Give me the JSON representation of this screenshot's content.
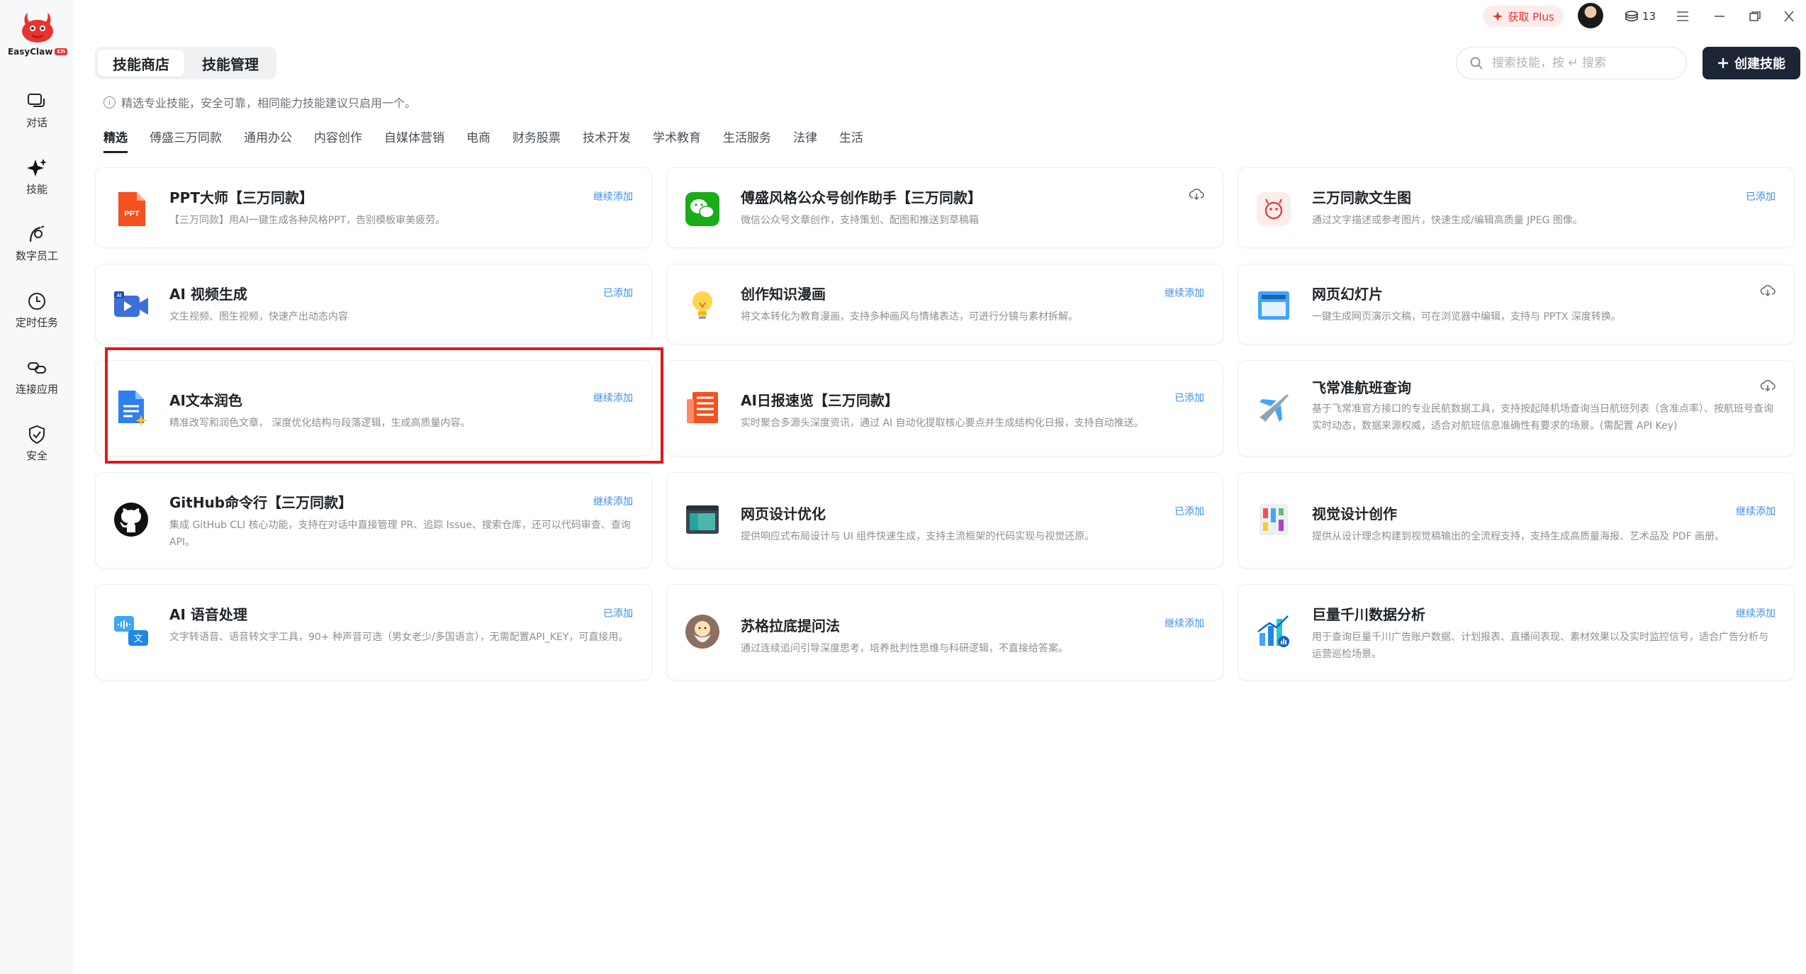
{
  "app": {
    "name": "EasyClaw",
    "badge": "cn"
  },
  "sidebar": {
    "items": [
      {
        "label": "对话",
        "icon": "chat-icon"
      },
      {
        "label": "技能",
        "icon": "sparkle-icon"
      },
      {
        "label": "数字员工",
        "icon": "digital-employee-icon"
      },
      {
        "label": "定时任务",
        "icon": "clock-icon"
      },
      {
        "label": "连接应用",
        "icon": "link-icon"
      },
      {
        "label": "安全",
        "icon": "shield-icon"
      }
    ]
  },
  "topbar": {
    "plus_label": "获取 Plus",
    "credits": "13"
  },
  "tabs": {
    "store": "技能商店",
    "manage": "技能管理"
  },
  "search": {
    "placeholder": "搜索技能，按 ↵ 搜索"
  },
  "create_button": "创建技能",
  "notice": "精选专业技能，安全可靠，相同能力技能建议只启用一个。",
  "categories": [
    "精选",
    "傅盛三万同款",
    "通用办公",
    "内容创作",
    "自媒体营销",
    "电商",
    "财务股票",
    "技术开发",
    "学术教育",
    "生活服务",
    "法律",
    "生活"
  ],
  "cards": [
    {
      "title": "PPT大师【三万同款】",
      "desc": "【三万同款】用AI一键生成各种风格PPT，告别模板审美疲劳。",
      "action": "继续添加",
      "icon": "ppt-icon"
    },
    {
      "title": "傅盛风格公众号创作助手【三万同款】",
      "desc": "微信公众号文章创作，支持策划、配图和推送到草稿箱",
      "action": "",
      "icon": "wechat-icon"
    },
    {
      "title": "三万同款文生图",
      "desc": "通过文字描述或参考图片，快速生成/编辑高质量 JPEG 图像。",
      "action": "已添加",
      "icon": "lobster-icon"
    },
    {
      "title": "AI 视频生成",
      "desc": "文生视频、图生视频，快速产出动态内容",
      "action": "已添加",
      "icon": "video-camera-icon"
    },
    {
      "title": "创作知识漫画",
      "desc": "将文本转化为教育漫画，支持多种画风与情绪表达，可进行分镜与素材拆解。",
      "action": "继续添加",
      "icon": "lightbulb-icon"
    },
    {
      "title": "网页幻灯片",
      "desc": "一键生成网页演示文稿，可在浏览器中编辑，支持与 PPTX 深度转换。",
      "action": "",
      "icon": "slides-icon"
    },
    {
      "title": "AI文本润色",
      "desc": "精准改写和润色文章， 深度优化结构与段落逻辑，生成高质量内容。",
      "action": "继续添加",
      "icon": "document-sparkle-icon"
    },
    {
      "title": "AI日报速览【三万同款】",
      "desc": "实时聚合多源头深度资讯，通过 AI 自动化提取核心要点并生成结构化日报，支持自动推送。",
      "action": "已添加",
      "icon": "newspaper-icon"
    },
    {
      "title": "飞常准航班查询",
      "desc": "基于飞常准官方接口的专业民航数据工具，支持按起降机场查询当日航班列表（含准点率）、按航班号查询实时动态，数据来源权威，适合对航班信息准确性有要求的场景。(需配置 API Key)",
      "action": "",
      "icon": "airplane-icon"
    },
    {
      "title": "GitHub命令行【三万同款】",
      "desc": "集成 GitHub CLI 核心功能，支持在对话中直接管理 PR、追踪 Issue、搜索仓库，还可以代码审查、查询API。",
      "action": "继续添加",
      "icon": "github-icon"
    },
    {
      "title": "网页设计优化",
      "desc": "提供响应式布局设计与 UI 组件快速生成，支持主流框架的代码实现与视觉还原。",
      "action": "已添加",
      "icon": "web-window-icon"
    },
    {
      "title": "视觉设计创作",
      "desc": "提供从设计理念构建到视觉稿输出的全流程支持，支持生成高质量海报、艺术品及 PDF 画册。",
      "action": "继续添加",
      "icon": "palette-icon"
    },
    {
      "title": "AI 语音处理",
      "desc": "文字转语音、语音转文字工具，90+ 种声音可选（男女老少/多国语言），无需配置API_KEY，可直接用。",
      "action": "已添加",
      "icon": "speech-translate-icon"
    },
    {
      "title": "苏格拉底提问法",
      "desc": "通过连续追问引导深度思考，培养批判性思维与科研逻辑，不直接给答案。",
      "action": "继续添加",
      "icon": "socrates-icon"
    },
    {
      "title": "巨量千川数据分析",
      "desc": "用于查询巨量千川广告账户数据、计划报表、直播间表现、素材效果以及实时监控信号，适合广告分析与运营巡检场景。",
      "action": "继续添加",
      "icon": "bar-chart-icon"
    }
  ]
}
